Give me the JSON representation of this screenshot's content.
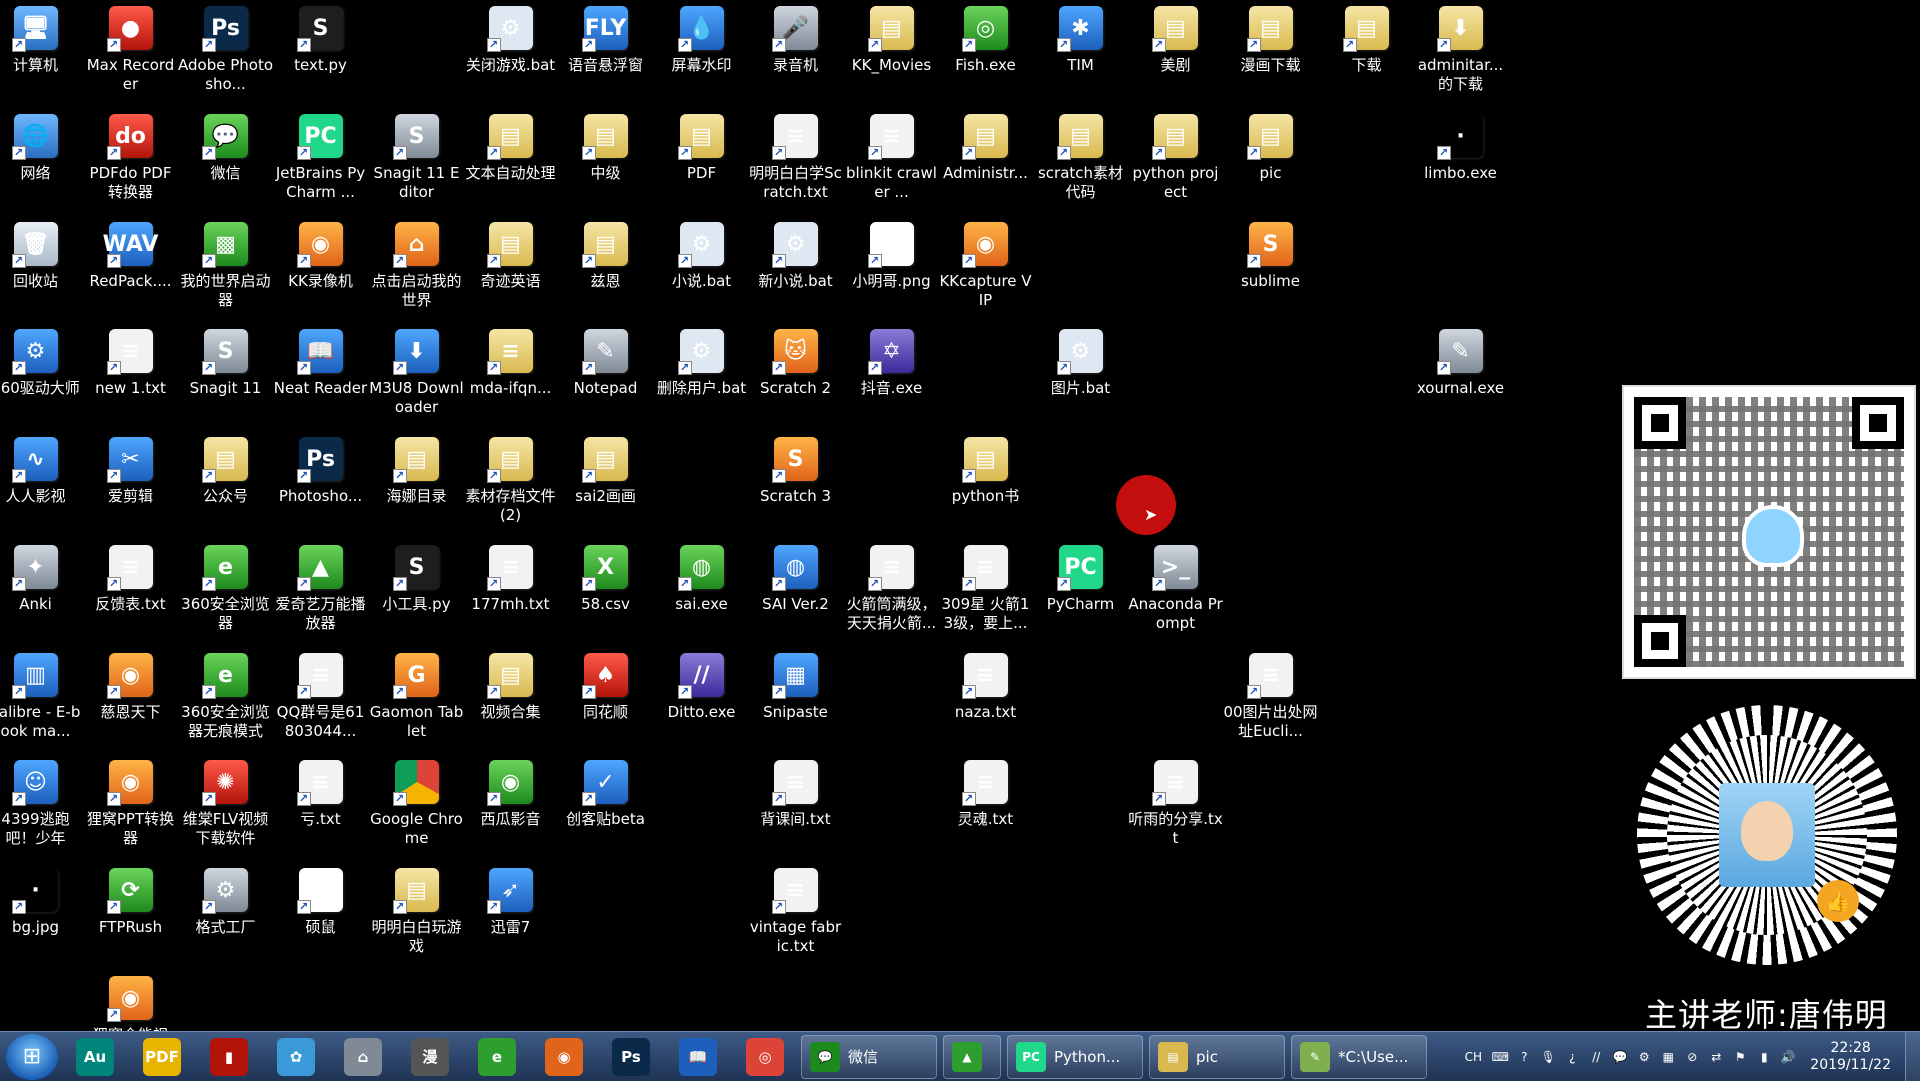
{
  "desktop_icons": [
    {
      "label": "计算机",
      "glyph": "🖥",
      "style": "g-monitor",
      "icon": "computer-icon"
    },
    {
      "label": "Max Recorder",
      "glyph": "●",
      "style": "g-red",
      "icon": "record-icon"
    },
    {
      "label": "Adobe Photosho...",
      "glyph": "Ps",
      "style": "g-ps",
      "icon": "photoshop-icon"
    },
    {
      "label": "text.py",
      "glyph": "S",
      "style": "g-py",
      "icon": "python-file-icon"
    },
    {
      "label": "关闭游戏.bat",
      "glyph": "⚙",
      "style": "g-bat",
      "icon": "batch-file-icon"
    },
    {
      "label": "语音悬浮窗",
      "glyph": "FLY",
      "style": "g-blue",
      "icon": "voice-icon"
    },
    {
      "label": "屏幕水印",
      "glyph": "💧",
      "style": "g-blue",
      "icon": "watermark-icon"
    },
    {
      "label": "录音机",
      "glyph": "🎤",
      "style": "g-gray",
      "icon": "microphone-icon"
    },
    {
      "label": "KK_Movies",
      "glyph": "▤",
      "style": "g-folder",
      "icon": "folder-icon"
    },
    {
      "label": "Fish.exe",
      "glyph": "◎",
      "style": "g-green",
      "icon": "fish-icon"
    },
    {
      "label": "TIM",
      "glyph": "✱",
      "style": "g-blue",
      "icon": "tim-icon"
    },
    {
      "label": "美剧",
      "glyph": "▤",
      "style": "g-folder",
      "icon": "folder-icon"
    },
    {
      "label": "漫画下载",
      "glyph": "▤",
      "style": "g-folder",
      "icon": "folder-icon"
    },
    {
      "label": "下载",
      "glyph": "▤",
      "style": "g-folder",
      "icon": "folder-icon"
    },
    {
      "label": "adminitar...的下载",
      "glyph": "⬇",
      "style": "g-folder",
      "icon": "download-folder-icon"
    },
    {
      "label": "网络",
      "glyph": "🌐",
      "style": "g-monitor",
      "icon": "network-icon"
    },
    {
      "label": "PDFdo PDF转换器",
      "glyph": "do",
      "style": "g-red",
      "icon": "pdf-converter-icon"
    },
    {
      "label": "微信",
      "glyph": "💬",
      "style": "g-green",
      "icon": "wechat-icon"
    },
    {
      "label": "JetBrains PyCharm ...",
      "glyph": "PC",
      "style": "g-pc",
      "icon": "pycharm-icon"
    },
    {
      "label": "Snagit 11 Editor",
      "glyph": "S",
      "style": "g-gray",
      "icon": "snagit-icon"
    },
    {
      "label": "文本自动处理",
      "glyph": "▤",
      "style": "g-folder",
      "icon": "folder-icon"
    },
    {
      "label": "中级",
      "glyph": "▤",
      "style": "g-folder",
      "icon": "folder-icon"
    },
    {
      "label": "PDF",
      "glyph": "▤",
      "style": "g-folder",
      "icon": "folder-icon"
    },
    {
      "label": "明明白白学Scratch.txt",
      "glyph": "≡",
      "style": "g-doc",
      "icon": "text-file-icon"
    },
    {
      "label": "blinkit crawler ...",
      "glyph": "≡",
      "style": "g-doc",
      "icon": "text-file-icon"
    },
    {
      "label": "Administr...",
      "glyph": "▤",
      "style": "g-folder",
      "icon": "folder-icon"
    },
    {
      "label": "scratch素材代码",
      "glyph": "▤",
      "style": "g-folder",
      "icon": "folder-icon"
    },
    {
      "label": "python project",
      "glyph": "▤",
      "style": "g-folder",
      "icon": "folder-icon"
    },
    {
      "label": "pic",
      "glyph": "▤",
      "style": "g-folder",
      "icon": "folder-icon"
    },
    {
      "label": "limbo.exe",
      "glyph": "·",
      "style": "g-img",
      "icon": "app-icon"
    },
    {
      "label": "回收站",
      "glyph": "🗑",
      "style": "g-recycle",
      "icon": "recycle-bin-icon"
    },
    {
      "label": "RedPack....",
      "glyph": "WAV",
      "style": "g-blue",
      "icon": "audio-file-icon"
    },
    {
      "label": "我的世界启动器",
      "glyph": "▩",
      "style": "g-green",
      "icon": "minecraft-icon"
    },
    {
      "label": "KK录像机",
      "glyph": "◉",
      "style": "g-orange",
      "icon": "kk-recorder-icon"
    },
    {
      "label": "点击启动我的世界",
      "glyph": "⌂",
      "style": "g-orange",
      "icon": "launcher-icon"
    },
    {
      "label": "奇迹英语",
      "glyph": "▤",
      "style": "g-folder",
      "icon": "folder-icon"
    },
    {
      "label": "兹恩",
      "glyph": "▤",
      "style": "g-folder",
      "icon": "folder-icon"
    },
    {
      "label": "小说.bat",
      "glyph": "⚙",
      "style": "g-bat",
      "icon": "batch-file-icon"
    },
    {
      "label": "新小说.bat",
      "glyph": "⚙",
      "style": "g-bat",
      "icon": "batch-file-icon"
    },
    {
      "label": "小明哥.png",
      "glyph": "☺",
      "style": "g-white",
      "icon": "image-file-icon"
    },
    {
      "label": "KKcapture VIP",
      "glyph": "◉",
      "style": "g-orange",
      "icon": "kkcapture-icon"
    },
    {
      "label": "sublime",
      "glyph": "S",
      "style": "g-orange",
      "icon": "sublime-icon"
    },
    {
      "label": "360驱动大师",
      "glyph": "⚙",
      "style": "g-blue",
      "icon": "driver-icon"
    },
    {
      "label": "new 1.txt",
      "glyph": "≡",
      "style": "g-doc",
      "icon": "text-file-icon"
    },
    {
      "label": "Snagit 11",
      "glyph": "S",
      "style": "g-gray",
      "icon": "snagit-icon"
    },
    {
      "label": "Neat Reader",
      "glyph": "📖",
      "style": "g-blue",
      "icon": "reader-icon"
    },
    {
      "label": "M3U8 Downloader",
      "glyph": "⬇",
      "style": "g-blue",
      "icon": "downloader-icon"
    },
    {
      "label": "mda-ifqn...",
      "glyph": "≡",
      "style": "g-folder",
      "icon": "text-file-icon"
    },
    {
      "label": "Notepad",
      "glyph": "✎",
      "style": "g-gray",
      "icon": "notepad-icon"
    },
    {
      "label": "删除用户.bat",
      "glyph": "⚙",
      "style": "g-bat",
      "icon": "batch-file-icon"
    },
    {
      "label": "Scratch 2",
      "glyph": "🐱",
      "style": "g-orange",
      "icon": "scratch-icon"
    },
    {
      "label": "抖音.exe",
      "glyph": "✡",
      "style": "g-purple",
      "icon": "douyin-icon"
    },
    {
      "label": "图片.bat",
      "glyph": "⚙",
      "style": "g-bat",
      "icon": "batch-file-icon"
    },
    {
      "label": "xournal.exe",
      "glyph": "✎",
      "style": "g-gray",
      "icon": "xournal-icon"
    },
    {
      "label": "人人影视",
      "glyph": "∿",
      "style": "g-blue",
      "icon": "video-app-icon"
    },
    {
      "label": "爱剪辑",
      "glyph": "✂",
      "style": "g-blue",
      "icon": "video-editor-icon"
    },
    {
      "label": "公众号",
      "glyph": "▤",
      "style": "g-folder",
      "icon": "folder-icon"
    },
    {
      "label": "Photosho...",
      "glyph": "Ps",
      "style": "g-ps",
      "icon": "photoshop-icon"
    },
    {
      "label": "海娜目录",
      "glyph": "▤",
      "style": "g-folder",
      "icon": "folder-icon"
    },
    {
      "label": "素材存档文件(2)",
      "glyph": "▤",
      "style": "g-folder",
      "icon": "folder-icon"
    },
    {
      "label": "sai2画画",
      "glyph": "▤",
      "style": "g-folder",
      "icon": "folder-icon"
    },
    {
      "label": "Scratch 3",
      "glyph": "S",
      "style": "g-orange",
      "icon": "scratch-icon"
    },
    {
      "label": "python书",
      "glyph": "▤",
      "style": "g-folder",
      "icon": "folder-icon"
    },
    {
      "label": "Anki",
      "glyph": "✦",
      "style": "g-gray",
      "icon": "anki-icon"
    },
    {
      "label": "反馈表.txt",
      "glyph": "≡",
      "style": "g-doc",
      "icon": "text-file-icon"
    },
    {
      "label": "360安全浏览器",
      "glyph": "e",
      "style": "g-green",
      "icon": "browser-icon"
    },
    {
      "label": "爱奇艺万能播放器",
      "glyph": "▲",
      "style": "g-green",
      "icon": "player-icon"
    },
    {
      "label": "小工具.py",
      "glyph": "S",
      "style": "g-py",
      "icon": "python-file-icon"
    },
    {
      "label": "177mh.txt",
      "glyph": "≡",
      "style": "g-doc",
      "icon": "text-file-icon"
    },
    {
      "label": "58.csv",
      "glyph": "X",
      "style": "g-green",
      "icon": "csv-file-icon"
    },
    {
      "label": "sai.exe",
      "glyph": "◍",
      "style": "g-green",
      "icon": "sai-icon"
    },
    {
      "label": "SAI Ver.2",
      "glyph": "◍",
      "style": "g-blue",
      "icon": "sai-icon"
    },
    {
      "label": "火箭筒满级，天天捐火箭...",
      "glyph": "≡",
      "style": "g-doc",
      "icon": "text-file-icon"
    },
    {
      "label": "309星 火箭13级，要上...",
      "glyph": "≡",
      "style": "g-doc",
      "icon": "text-file-icon"
    },
    {
      "label": "PyCharm",
      "glyph": "PC",
      "style": "g-pc",
      "icon": "pycharm-icon"
    },
    {
      "label": "Anaconda Prompt",
      "glyph": ">_",
      "style": "g-gray",
      "icon": "terminal-icon"
    },
    {
      "label": "calibre - E-book ma...",
      "glyph": "▥",
      "style": "g-blue",
      "icon": "calibre-icon"
    },
    {
      "label": "慈恩天下",
      "glyph": "◉",
      "style": "g-orange",
      "icon": "app-icon"
    },
    {
      "label": "360安全浏览器无痕模式",
      "glyph": "e",
      "style": "g-green",
      "icon": "browser-icon"
    },
    {
      "label": "QQ群号是61803044...",
      "glyph": "≡",
      "style": "g-doc",
      "icon": "text-file-icon"
    },
    {
      "label": "Gaomon Tablet",
      "glyph": "G",
      "style": "g-orange",
      "icon": "tablet-icon"
    },
    {
      "label": "视频合集",
      "glyph": "▤",
      "style": "g-folder",
      "icon": "folder-icon"
    },
    {
      "label": "同花顺",
      "glyph": "♠",
      "style": "g-red",
      "icon": "stock-app-icon"
    },
    {
      "label": "Ditto.exe",
      "glyph": "//",
      "style": "g-purple",
      "icon": "ditto-icon"
    },
    {
      "label": "Snipaste",
      "glyph": "▦",
      "style": "g-blue",
      "icon": "snipaste-icon"
    },
    {
      "label": "naza.txt",
      "glyph": "≡",
      "style": "g-doc",
      "icon": "text-file-icon"
    },
    {
      "label": "00图片出处网址Eucli...",
      "glyph": "≡",
      "style": "g-doc",
      "icon": "text-file-icon"
    },
    {
      "label": "4399逃跑吧！少年",
      "glyph": "☺",
      "style": "g-blue",
      "icon": "game-icon"
    },
    {
      "label": "狸窝PPT转换器",
      "glyph": "◉",
      "style": "g-orange",
      "icon": "ppt-converter-icon"
    },
    {
      "label": "维棠FLV视频下载软件",
      "glyph": "✺",
      "style": "g-red",
      "icon": "flv-downloader-icon"
    },
    {
      "label": "亏.txt",
      "glyph": "≡",
      "style": "g-doc",
      "icon": "text-file-icon"
    },
    {
      "label": "Google Chrome",
      "glyph": "",
      "style": "g-chrome",
      "icon": "chrome-icon"
    },
    {
      "label": "西瓜影音",
      "glyph": "◉",
      "style": "g-green",
      "icon": "video-player-icon"
    },
    {
      "label": "创客贴beta",
      "glyph": "✓",
      "style": "g-blue",
      "icon": "design-app-icon"
    },
    {
      "label": "背课间.txt",
      "glyph": "≡",
      "style": "g-doc",
      "icon": "text-file-icon"
    },
    {
      "label": "灵魂.txt",
      "glyph": "≡",
      "style": "g-doc",
      "icon": "text-file-icon"
    },
    {
      "label": "听雨的分享.txt",
      "glyph": "≡",
      "style": "g-doc",
      "icon": "text-file-icon"
    },
    {
      "label": "bg.jpg",
      "glyph": "·",
      "style": "g-img",
      "icon": "image-file-icon"
    },
    {
      "label": "FTPRush",
      "glyph": "⟳",
      "style": "g-green",
      "icon": "ftp-icon"
    },
    {
      "label": "格式工厂",
      "glyph": "⚙",
      "style": "g-gray",
      "icon": "format-factory-icon"
    },
    {
      "label": "硕鼠",
      "glyph": "🐭",
      "style": "g-white",
      "icon": "mouse-app-icon"
    },
    {
      "label": "明明白白玩游戏",
      "glyph": "▤",
      "style": "g-folder",
      "icon": "folder-icon"
    },
    {
      "label": "迅雷7",
      "glyph": "➶",
      "style": "g-blue",
      "icon": "thunder-icon"
    },
    {
      "label": "vintage fabric.txt",
      "glyph": "≡",
      "style": "g-doc",
      "icon": "text-file-icon"
    },
    {
      "label": "狸窝全能视频...",
      "glyph": "◉",
      "style": "g-orange",
      "icon": "video-converter-icon"
    }
  ],
  "watermark": {
    "teacher_caption": "主讲老师:唐伟明"
  },
  "taskbar": {
    "start_glyph": "⊞",
    "pinned": [
      {
        "glyph": "Au",
        "color": "#00857a",
        "icon": "audition-icon"
      },
      {
        "glyph": "PDF",
        "color": "#e8b400",
        "icon": "pdf-icon"
      },
      {
        "glyph": "▮",
        "color": "#b3140a",
        "icon": "book-icon"
      },
      {
        "glyph": "✿",
        "color": "#3a9ad9",
        "icon": "photos-icon"
      },
      {
        "glyph": "⌂",
        "color": "#7f8a96",
        "icon": "launcher-icon"
      },
      {
        "glyph": "漫",
        "color": "#555555",
        "icon": "comic-icon"
      },
      {
        "glyph": "e",
        "color": "#2e9e2e",
        "icon": "browser-icon"
      },
      {
        "glyph": "◉",
        "color": "#e0641a",
        "icon": "recorder-icon"
      },
      {
        "glyph": "Ps",
        "color": "#0b2a4a",
        "icon": "photoshop-icon"
      },
      {
        "glyph": "📖",
        "color": "#1d5fbd",
        "icon": "reader-icon"
      },
      {
        "glyph": "◎",
        "color": "#db4437",
        "icon": "chrome-icon"
      }
    ],
    "tasks": [
      {
        "label": "微信",
        "glyph": "💬",
        "color": "#1d8a1d",
        "icon": "wechat-icon",
        "name": "taskbar-wechat"
      },
      {
        "label": "",
        "glyph": "▲",
        "color": "#2e9e2e",
        "icon": "player-icon",
        "name": "taskbar-player"
      },
      {
        "label": "Python...",
        "glyph": "PC",
        "color": "#21d789",
        "icon": "pycharm-icon",
        "name": "taskbar-pycharm"
      },
      {
        "label": "pic",
        "glyph": "▤",
        "color": "#d9b94f",
        "icon": "folder-icon",
        "name": "taskbar-pic-folder"
      },
      {
        "label": "*C:\\Use...",
        "glyph": "✎",
        "color": "#7fb04f",
        "icon": "notepad-icon",
        "name": "taskbar-notepad"
      }
    ],
    "tray": {
      "lang": "CH",
      "icons": [
        "keyboard-icon",
        "help-icon",
        "mic-icon",
        "question-icon",
        "ditto-tray-icon",
        "wechat-tray-icon",
        "settings-tray-icon",
        "color-tray-icon",
        "stop-tray-icon",
        "network-tray-icon",
        "flag-icon",
        "signal-icon",
        "volume-icon"
      ],
      "glyphs": [
        "⌨",
        "?",
        "🎙",
        "¿",
        "//",
        "💬",
        "⚙",
        "▦",
        "⊘",
        "⇄",
        "⚑",
        "▮",
        "🔊"
      ]
    },
    "clock": {
      "time": "22:28",
      "date": "2019/11/22"
    }
  }
}
